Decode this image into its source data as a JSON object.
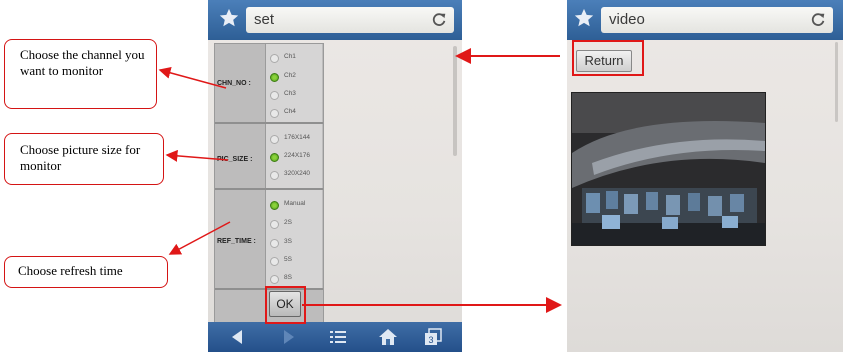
{
  "callouts": {
    "channel": "Choose the channel you want to monitor",
    "pic_size": "Choose picture size for monitor",
    "refresh": "Choose refresh time"
  },
  "set_screen": {
    "url": "set",
    "groups": [
      {
        "label": "CHN_NO :",
        "options": [
          {
            "text": "Ch1",
            "selected": false
          },
          {
            "text": "Ch2",
            "selected": true
          },
          {
            "text": "Ch3",
            "selected": false
          },
          {
            "text": "Ch4",
            "selected": false
          }
        ]
      },
      {
        "label": "PIC_SIZE :",
        "options": [
          {
            "text": "176X144",
            "selected": false
          },
          {
            "text": "224X176",
            "selected": true
          },
          {
            "text": "320X240",
            "selected": false
          }
        ]
      },
      {
        "label": "REF_TIME :",
        "options": [
          {
            "text": "Manual",
            "selected": true
          },
          {
            "text": "2S",
            "selected": false
          },
          {
            "text": "3S",
            "selected": false
          },
          {
            "text": "5S",
            "selected": false
          },
          {
            "text": "8S",
            "selected": false
          }
        ]
      }
    ],
    "ok_label": "OK",
    "tab_count": "3"
  },
  "video_screen": {
    "url": "video",
    "return_label": "Return"
  },
  "colors": {
    "accent": "#e01818",
    "topbar": "#2e5f96",
    "radio_on": "#6cc02a"
  }
}
